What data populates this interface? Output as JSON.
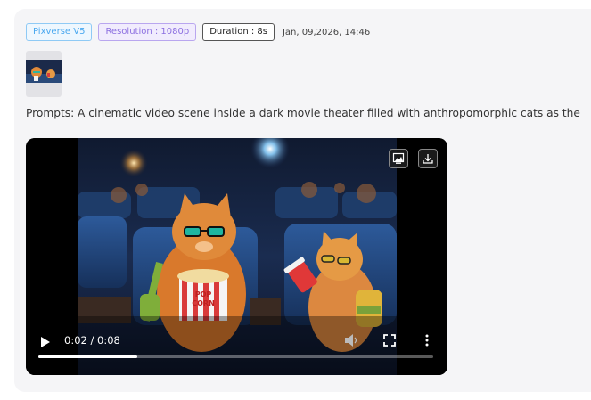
{
  "tags": {
    "model": "Pixverse V5",
    "resolution": "Resolution : 1080p",
    "duration": "Duration : 8s"
  },
  "date": "Jan, 09,2026, 14:46",
  "prompt": "Prompts: A cinematic video scene inside a dark movie theater filled with anthropomorphic cats as the",
  "video": {
    "current_time": "0:02",
    "total_time": "0:08",
    "time_text": "0:02 / 0:08",
    "progress": 0.25,
    "popcorn_text_top": "POP",
    "popcorn_text_bottom": "CORN"
  },
  "colors": {
    "model_tag": "#4aa8ef",
    "resolution_tag": "#8c6fe0",
    "video_bg": "#000000"
  },
  "icons": {
    "frame_button": "image-frame-icon",
    "download_button": "download-icon",
    "play": "play-icon",
    "volume": "volume-icon",
    "fullscreen": "fullscreen-icon",
    "more": "more-vertical-icon"
  }
}
